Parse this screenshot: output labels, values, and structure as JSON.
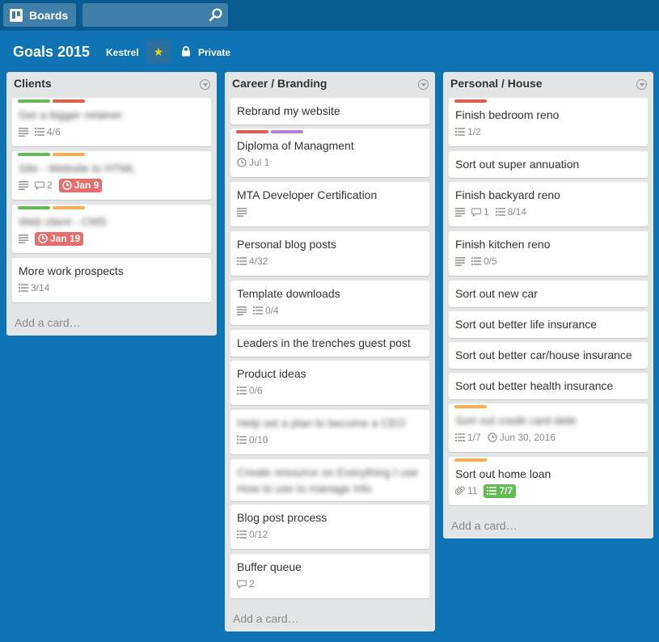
{
  "header": {
    "boards_label": "Boards",
    "search_value": ""
  },
  "board": {
    "title": "Goals 2015",
    "team": "Kestrel",
    "visibility": "Private"
  },
  "colors": {
    "green": "#61bd4f",
    "red": "#eb5a46",
    "orange": "#ffab4a",
    "purple": "#c377e0"
  },
  "lists": [
    {
      "title": "Clients",
      "add_card": "Add a card…",
      "cards": [
        {
          "title": "Get a bigger retainer",
          "blur": true,
          "labels": [
            "green",
            "red"
          ],
          "badges": [
            {
              "type": "desc"
            },
            {
              "type": "check",
              "text": "4/6"
            }
          ]
        },
        {
          "title": "Site - Website to HTML",
          "blur": true,
          "labels": [
            "green",
            "orange"
          ],
          "badges": [
            {
              "type": "desc"
            },
            {
              "type": "comment",
              "text": "2"
            },
            {
              "type": "due-red",
              "text": "Jan 9"
            }
          ]
        },
        {
          "title": "Web client - CMS",
          "blur": true,
          "labels": [
            "green",
            "orange"
          ],
          "badges": [
            {
              "type": "desc"
            },
            {
              "type": "due-red",
              "text": "Jan 19"
            }
          ]
        },
        {
          "title": "More work prospects",
          "blur": false,
          "labels": [],
          "badges": [
            {
              "type": "check",
              "text": "3/14"
            }
          ]
        }
      ]
    },
    {
      "title": "Career / Branding",
      "add_card": "Add a card…",
      "cards": [
        {
          "title": "Rebrand my website",
          "blur": false,
          "labels": [],
          "badges": []
        },
        {
          "title": "Diploma of Managment",
          "blur": false,
          "labels": [
            "red",
            "purple"
          ],
          "badges": [
            {
              "type": "date",
              "text": "Jul 1"
            }
          ]
        },
        {
          "title": "MTA Developer Certification",
          "blur": false,
          "labels": [],
          "badges": [
            {
              "type": "desc"
            }
          ]
        },
        {
          "title": "Personal blog posts",
          "blur": false,
          "labels": [],
          "badges": [
            {
              "type": "check",
              "text": "4/32"
            }
          ]
        },
        {
          "title": "Template downloads",
          "blur": false,
          "labels": [],
          "badges": [
            {
              "type": "desc"
            },
            {
              "type": "check",
              "text": "0/4"
            }
          ]
        },
        {
          "title": "Leaders in the trenches guest post",
          "blur": false,
          "labels": [],
          "badges": []
        },
        {
          "title": "Product ideas",
          "blur": false,
          "labels": [],
          "badges": [
            {
              "type": "check",
              "text": "0/6"
            }
          ]
        },
        {
          "title": "Help set a plan to become a CEO",
          "blur": true,
          "labels": [],
          "badges": [
            {
              "type": "check",
              "text": "0/10"
            }
          ]
        },
        {
          "title": "Create resource on Everything I use",
          "title2": "How to use to manage info",
          "blur": true,
          "labels": [],
          "badges": []
        },
        {
          "title": "Blog post process",
          "blur": false,
          "labels": [],
          "badges": [
            {
              "type": "check",
              "text": "0/12"
            }
          ]
        },
        {
          "title": "Buffer queue",
          "blur": false,
          "labels": [],
          "badges": [
            {
              "type": "comment",
              "text": "2"
            }
          ]
        }
      ]
    },
    {
      "title": "Personal / House",
      "add_card": "Add a card…",
      "cards": [
        {
          "title": "Finish bedroom reno",
          "blur": false,
          "labels": [
            "red"
          ],
          "badges": [
            {
              "type": "check",
              "text": "1/2"
            }
          ]
        },
        {
          "title": "Sort out super annuation",
          "blur": false,
          "labels": [],
          "badges": []
        },
        {
          "title": "Finish backyard reno",
          "blur": false,
          "labels": [],
          "badges": [
            {
              "type": "desc"
            },
            {
              "type": "comment",
              "text": "1"
            },
            {
              "type": "check",
              "text": "8/14"
            }
          ]
        },
        {
          "title": "Finish kitchen reno",
          "blur": false,
          "labels": [],
          "badges": [
            {
              "type": "desc"
            },
            {
              "type": "check",
              "text": "0/5"
            }
          ]
        },
        {
          "title": "Sort out new car",
          "blur": false,
          "labels": [],
          "badges": []
        },
        {
          "title": "Sort out better life insurance",
          "blur": false,
          "labels": [],
          "badges": []
        },
        {
          "title": "Sort out better car/house insurance",
          "blur": false,
          "labels": [],
          "badges": []
        },
        {
          "title": "Sort out better health insurance",
          "blur": false,
          "labels": [],
          "badges": []
        },
        {
          "title": "Sort out credit card debt",
          "blur": true,
          "labels": [
            "orange"
          ],
          "badges": [
            {
              "type": "check",
              "text": "1/7"
            },
            {
              "type": "date",
              "text": "Jun 30, 2016"
            }
          ]
        },
        {
          "title": "Sort out home loan",
          "blur": false,
          "labels": [
            "orange"
          ],
          "badges": [
            {
              "type": "attach",
              "text": "11"
            },
            {
              "type": "check-green",
              "text": "7/7"
            }
          ]
        }
      ]
    }
  ]
}
